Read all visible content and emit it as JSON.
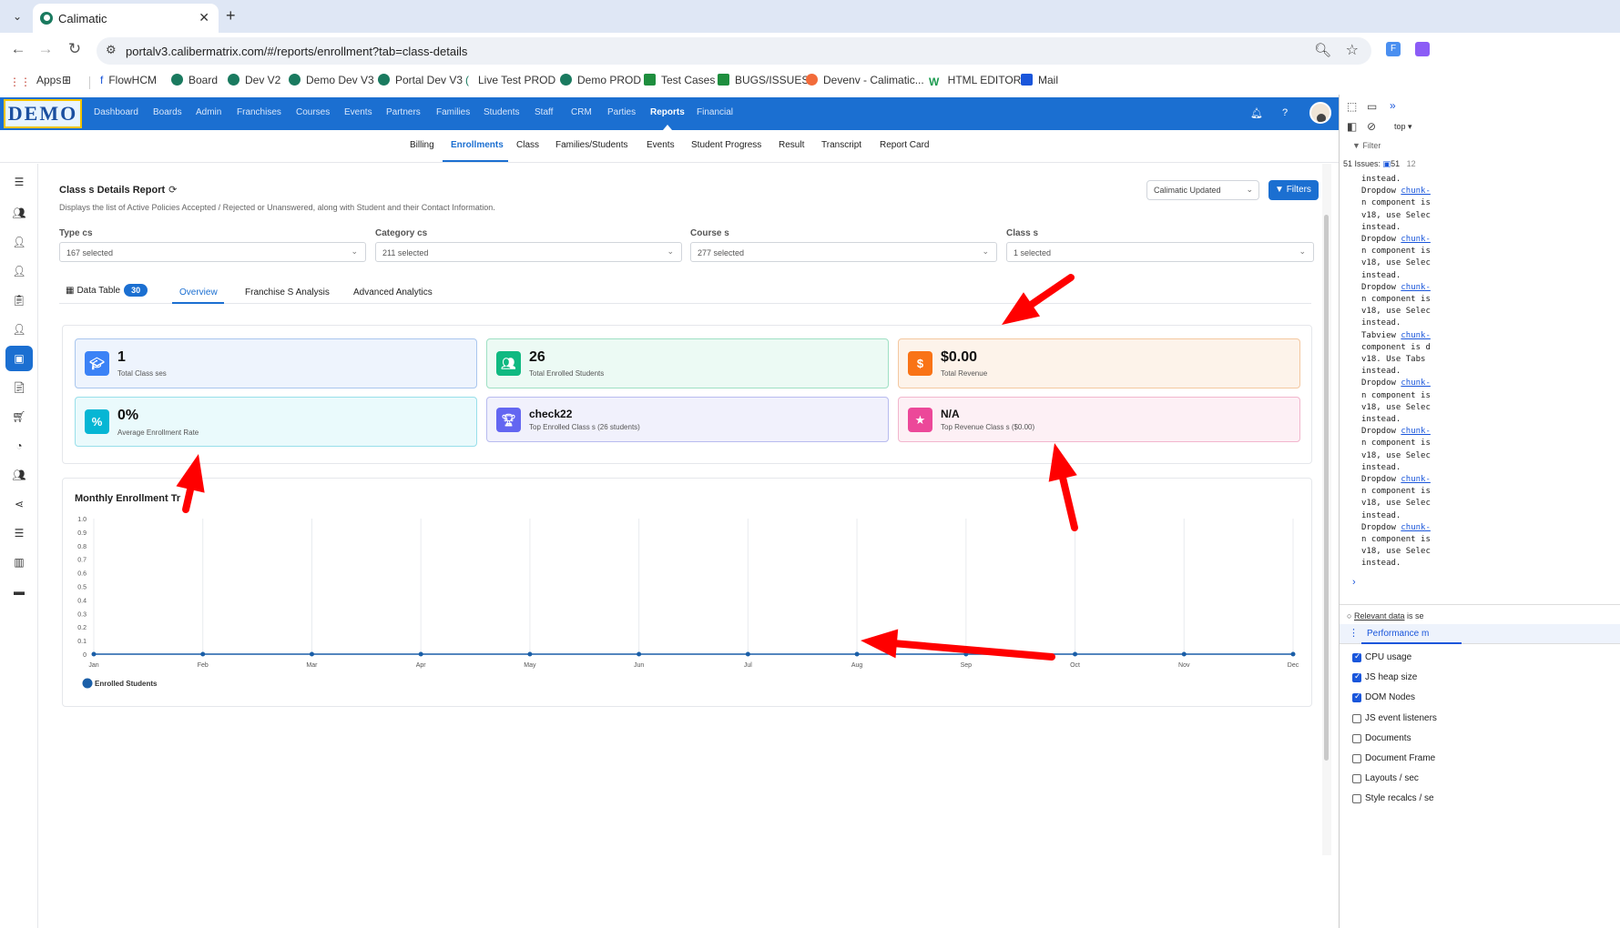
{
  "browser": {
    "tab_title": "Calimatic",
    "url": "portalv3.calibermatrix.com/#/reports/enrollment?tab=class-details",
    "bookmarks": [
      "Apps",
      "FlowHCM",
      "Board",
      "Dev V2",
      "Demo Dev V3",
      "Portal Dev V3",
      "Live Test PROD",
      "Demo PROD",
      "Test Cases",
      "BUGS/ISSUES",
      "Devenv - Calimatic...",
      "HTML EDITOR",
      "Mail"
    ]
  },
  "app": {
    "logo": "DEMO",
    "nav": [
      "Dashboard",
      "Boards",
      "Admin",
      "Franchises",
      "Courses",
      "Events",
      "Partners",
      "Families",
      "Students",
      "Staff",
      "CRM",
      "Parties",
      "Reports",
      "Financial"
    ],
    "active_nav": "Reports",
    "subnav": [
      "Billing",
      "Enrollments",
      "Class",
      "Families/Students",
      "Events",
      "Student Progress",
      "Result",
      "Transcript",
      "Report Card"
    ],
    "active_subnav": "Enrollments"
  },
  "report": {
    "title": "Class s Details Report",
    "description": "Displays the list of Active Policies Accepted / Rejected or Unanswered, along with Student and their Contact Information.",
    "preference": "Calimatic Updated",
    "filters_label": "Filters",
    "filters": [
      {
        "label": "Type cs",
        "value": "167 selected"
      },
      {
        "label": "Category cs",
        "value": "211 selected"
      },
      {
        "label": "Course s",
        "value": "277 selected"
      },
      {
        "label": "Class s",
        "value": "1 selected"
      }
    ],
    "tabs": [
      {
        "label": "Data Table",
        "badge": "30"
      },
      {
        "label": "Overview"
      },
      {
        "label": "Franchise S Analysis"
      },
      {
        "label": "Advanced Analytics"
      }
    ],
    "active_tab": "Overview"
  },
  "stats": [
    {
      "value": "1",
      "label": "Total Class ses",
      "icon": "graduation-cap-icon",
      "color": "#3b82f6"
    },
    {
      "value": "26",
      "label": "Total Enrolled Students",
      "icon": "users-icon",
      "color": "#10b981"
    },
    {
      "value": "$0.00",
      "label": "Total Revenue",
      "icon": "dollar-icon",
      "color": "#f97316"
    },
    {
      "value": "0%",
      "label": "Average Enrollment Rate",
      "icon": "percent-icon",
      "color": "#06b6d4"
    },
    {
      "value": "check22",
      "label": "Top Enrolled Class s (26 students)",
      "icon": "trophy-icon",
      "color": "#6366f1"
    },
    {
      "value": "N/A",
      "label": "Top Revenue Class s ($0.00)",
      "icon": "star-icon",
      "color": "#ec4899"
    }
  ],
  "chart_data": {
    "type": "line",
    "title": "Monthly Enrollment Tr",
    "categories": [
      "Jan",
      "Feb",
      "Mar",
      "Apr",
      "May",
      "Jun",
      "Jul",
      "Aug",
      "Sep",
      "Oct",
      "Nov",
      "Dec"
    ],
    "series": [
      {
        "name": "Enrolled Students",
        "values": [
          0,
          0,
          0,
          0,
          0,
          0,
          0,
          0,
          0,
          0,
          0,
          0
        ]
      }
    ],
    "y_ticks": [
      "0",
      "0.1",
      "0.2",
      "0.3",
      "0.4",
      "0.5",
      "0.6",
      "0.7",
      "0.8",
      "0.9",
      "1.0"
    ],
    "ylim": [
      0,
      1
    ],
    "grid": "vertical",
    "legend": "bottom-left",
    "line_color": "#1b5fa8"
  },
  "devtools": {
    "target": "top",
    "filter_placeholder": "Filter",
    "issues": "51 Issues:",
    "issues_count": "51",
    "issues_other": "12",
    "console_lines": [
      "instead.",
      "Dropdow chunk-",
      "n component is",
      "v18, use Selec",
      "instead.",
      "Dropdow chunk-",
      "n component is",
      "v18, use Selec",
      "instead.",
      "Dropdow chunk-",
      "n component is",
      "v18, use Selec",
      "instead.",
      "Tabview chunk-",
      "component is d",
      "v18. Use Tabs",
      "instead.",
      "Dropdow chunk-",
      "n component is",
      "v18, use Selec",
      "instead.",
      "Dropdow chunk-",
      "n component is",
      "v18, use Selec",
      "instead.",
      "Dropdow chunk-",
      "n component is",
      "v18, use Selec",
      "instead.",
      "Dropdow chunk-",
      "n component is",
      "v18, use Selec",
      "instead."
    ],
    "relevant_data": "Relevant data",
    "relevant_suffix": "is se",
    "perf_tab": "Performance m",
    "metrics": [
      {
        "label": "CPU usage",
        "checked": true
      },
      {
        "label": "JS heap size",
        "checked": true
      },
      {
        "label": "DOM Nodes",
        "checked": true
      },
      {
        "label": "JS event listeners",
        "checked": false
      },
      {
        "label": "Documents",
        "checked": false
      },
      {
        "label": "Document Frame",
        "checked": false
      },
      {
        "label": "Layouts / sec",
        "checked": false
      },
      {
        "label": "Style recalcs / se",
        "checked": false
      }
    ]
  },
  "annotation_color": "#ff0000"
}
